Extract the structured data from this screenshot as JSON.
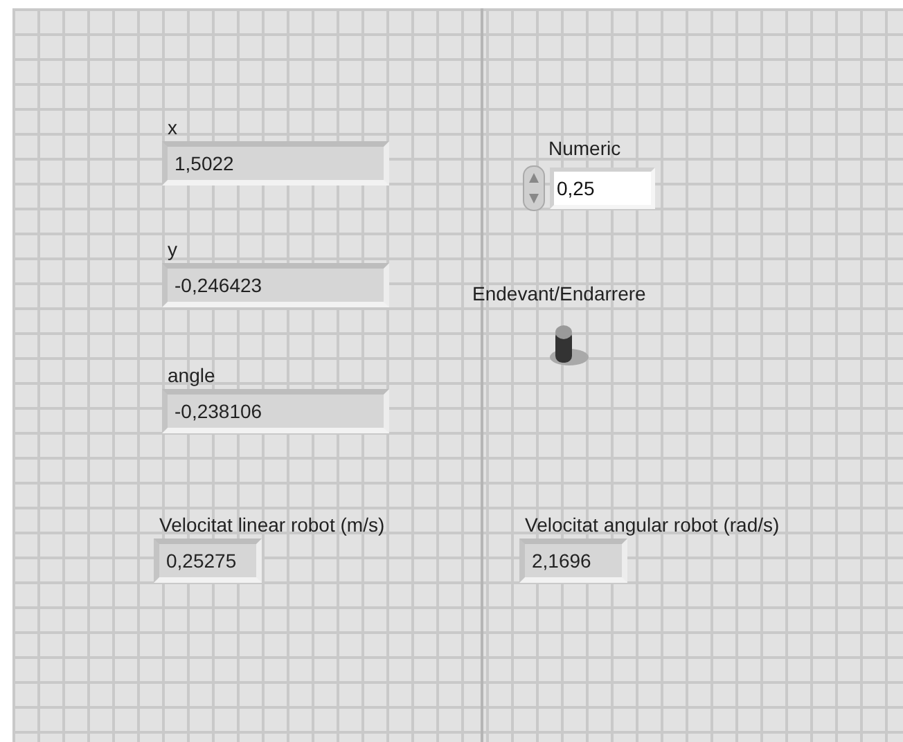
{
  "controls": [
    {
      "kind": "indicator",
      "label": "x",
      "value": "1,5022"
    },
    {
      "kind": "indicator",
      "label": "y",
      "value": "-0,246423"
    },
    {
      "kind": "indicator",
      "label": "angle",
      "value": "-0,238106"
    },
    {
      "kind": "numeric",
      "label": "Numeric",
      "value": "0,25"
    },
    {
      "kind": "toggle",
      "label": "Endevant/Endarrere",
      "on": false
    },
    {
      "kind": "small-indicator",
      "label": "Velocitat linear robot (m/s)",
      "value": "0,25275"
    },
    {
      "kind": "small-indicator",
      "label": "Velocitat angular robot (rad/s)",
      "value": "2,1696"
    }
  ]
}
